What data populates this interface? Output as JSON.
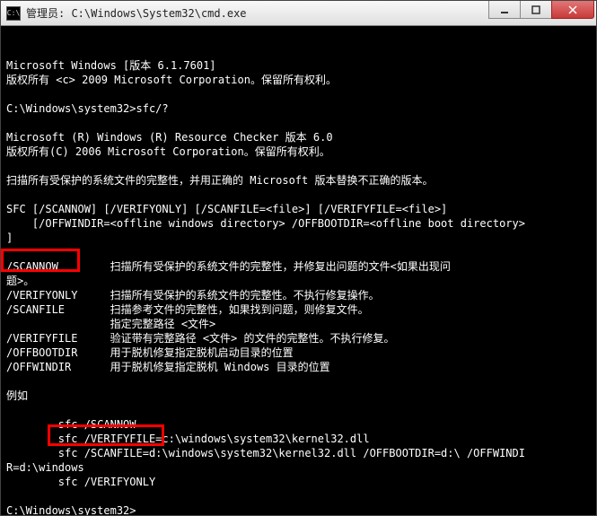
{
  "titlebar": {
    "icon_label": "C:\\",
    "title": "管理员: C:\\Windows\\System32\\cmd.exe"
  },
  "buttons": {
    "minimize": "minimize",
    "maximize": "maximize",
    "close": "close"
  },
  "lines": {
    "l00": "",
    "l01": "Microsoft Windows [版本 6.1.7601]",
    "l02": "版权所有 <c> 2009 Microsoft Corporation。保留所有权利。",
    "l03": "",
    "l04": "C:\\Windows\\system32>sfc/?",
    "l05": "",
    "l06": "Microsoft (R) Windows (R) Resource Checker 版本 6.0",
    "l07": "版权所有(C) 2006 Microsoft Corporation。保留所有权利。",
    "l08": "",
    "l09": "扫描所有受保护的系统文件的完整性，并用正确的 Microsoft 版本替换不正确的版本。",
    "l10": "",
    "l11": "SFC [/SCANNOW] [/VERIFYONLY] [/SCANFILE=<file>] [/VERIFYFILE=<file>]",
    "l12": "    [/OFFWINDIR=<offline windows directory> /OFFBOOTDIR=<offline boot directory>",
    "l13": "]",
    "l14": "",
    "l15": "/SCANNOW        扫描所有受保护的系统文件的完整性，并修复出问题的文件<如果出现问",
    "l16": "题>。",
    "l17": "/VERIFYONLY     扫描所有受保护的系统文件的完整性。不执行修复操作。",
    "l18": "/SCANFILE       扫描参考文件的完整性，如果找到问题，则修复文件。",
    "l19": "                指定完整路径 <文件>",
    "l20": "/VERIFYFILE     验证带有完整路径 <文件> 的文件的完整性。不执行修复。",
    "l21": "/OFFBOOTDIR     用于脱机修复指定脱机启动目录的位置",
    "l22": "/OFFWINDIR      用于脱机修复指定脱机 Windows 目录的位置",
    "l23": "",
    "l24": "例如",
    "l25": "",
    "l26": "        sfc /SCANNOW",
    "l27": "        sfc /VERIFYFILE=c:\\windows\\system32\\kernel32.dll",
    "l28": "        sfc /SCANFILE=d:\\windows\\system32\\kernel32.dll /OFFBOOTDIR=d:\\ /OFFWINDI",
    "l29": "R=d:\\windows",
    "l30": "        sfc /VERIFYONLY",
    "l31": "",
    "l32": "C:\\Windows\\system32>"
  },
  "highlights": {
    "scannow_option": "/SCANNOW",
    "example_cmd": "sfc /SCANNOW"
  }
}
